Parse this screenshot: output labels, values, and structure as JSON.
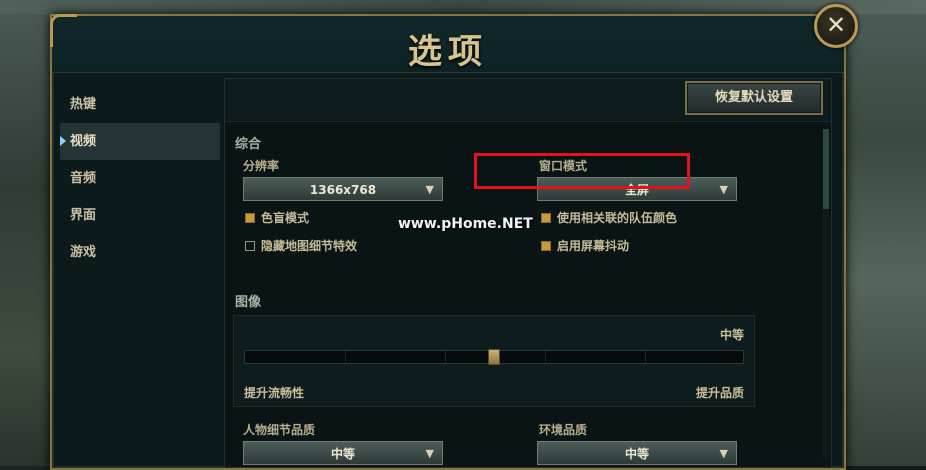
{
  "window": {
    "title": "选项",
    "close_glyph": "✕"
  },
  "sidebar": {
    "items": [
      {
        "label": "热键",
        "active": false
      },
      {
        "label": "视频",
        "active": true
      },
      {
        "label": "音频",
        "active": false
      },
      {
        "label": "界面",
        "active": false
      },
      {
        "label": "游戏",
        "active": false
      }
    ]
  },
  "panel": {
    "restore_label": "恢复默认设置",
    "general": {
      "section_label": "综合",
      "resolution_label": "分辨率",
      "resolution_value": "1366x768",
      "window_mode_label": "窗口模式",
      "window_mode_value": "全屏",
      "checkboxes": [
        {
          "label": "色盲模式",
          "checked": true
        },
        {
          "label": "隐藏地图细节特效",
          "checked": false
        },
        {
          "label": "使用相关联的队伍颜色",
          "checked": true
        },
        {
          "label": "启用屏幕抖动",
          "checked": true
        }
      ]
    },
    "graphics": {
      "section_label": "图像",
      "level_label": "中等",
      "slider_value": 0.5,
      "left_label": "提升流畅性",
      "right_label": "提升品质"
    },
    "character_quality": {
      "label": "人物细节品质",
      "value": "中等"
    },
    "environment_quality": {
      "label": "环境品质",
      "value": "中等"
    }
  },
  "watermark": "www.pHome.NET",
  "colors": {
    "accent_gold": "#b89a55",
    "highlight_red": "#e2141b",
    "checkbox_on": "#c89a3a"
  },
  "icons": {
    "close": "close-icon",
    "dropdown": "chevron-down-icon",
    "active_marker": "triangle-right-icon"
  }
}
